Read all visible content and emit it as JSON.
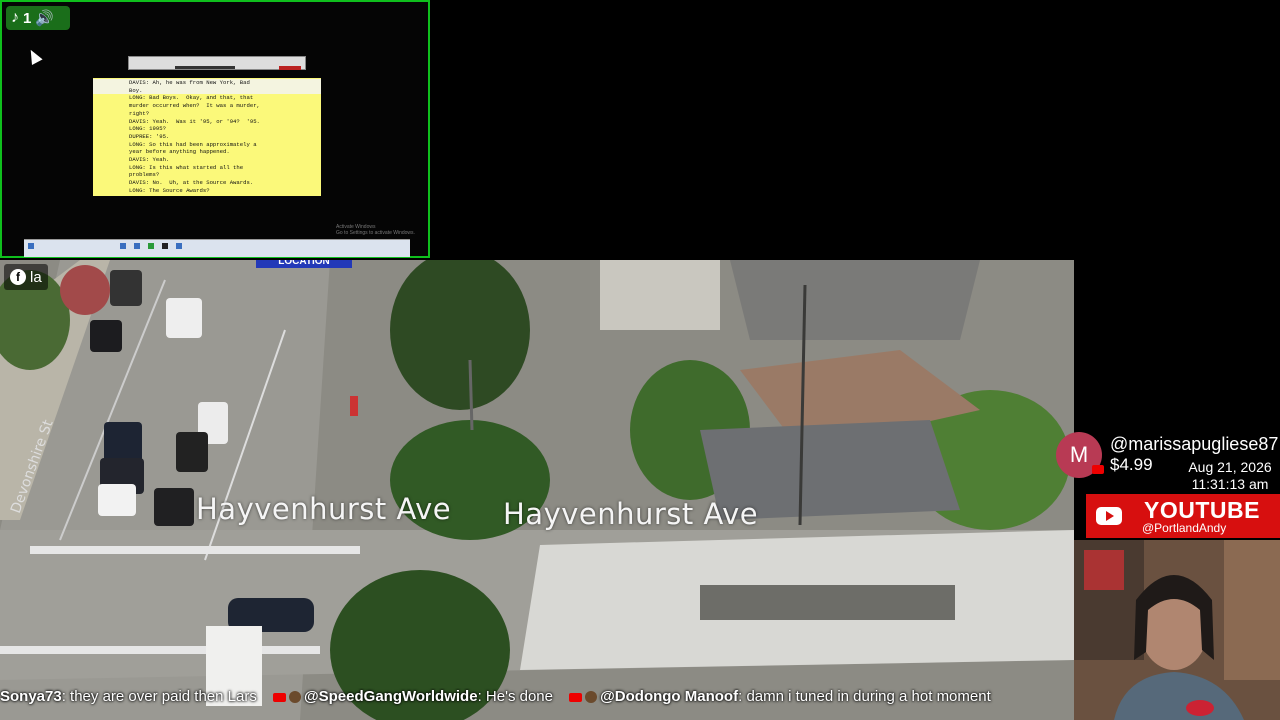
{
  "tiktok": {
    "count": "1"
  },
  "facebook": {
    "label": "la"
  },
  "document": {
    "lines": [
      "DAVIS: Ah, he was from New York, Bad",
      "Boy.",
      "LONG: Bad Boys.  Okay, and that, that",
      "murder occurred when?  It was a murder,",
      "right?",
      "DAVIS: Yeah.  Was it '95, or '94?  '95.",
      "LONG: 1995?",
      "DUPREE: '95.",
      "LONG: So this had been approximately a",
      "year before anything happened.",
      "DAVIS: Yeah.",
      "LONG: Is this what started all the",
      "problems?",
      "DAVIS: No.  Uh, at the Source Awards.",
      "LONG: The Source Awards?"
    ],
    "watermark": "Activate Windows\nGo to Settings to activate Windows."
  },
  "video": {
    "location_tag": "LOCATION",
    "street_label_1": "Hayvenhurst Ave",
    "street_label_2": "Hayvenhurst Ave",
    "cross_street": "Devonshire St"
  },
  "donation": {
    "avatar_letter": "M",
    "name": "@marissapugliese87",
    "amount": "$4.99",
    "date": "Aug 21, 2026",
    "time": "11:31:13 am"
  },
  "youtube_banner": {
    "title": "YOUTUBE",
    "handle": "@PortlandAndy"
  },
  "chat": [
    {
      "user": "Sonya73",
      "text": "they are over paid then Lars",
      "source": "youtube"
    },
    {
      "user": "@SpeedGangWorldwide",
      "text": "He's done",
      "source": "youtube"
    },
    {
      "user": "@Dodongo Manoof",
      "text": "damn i tuned in during a hot moment",
      "source": "youtube"
    }
  ],
  "colors": {
    "share_border": "#0fbf1d",
    "youtube_red": "#d70f0f",
    "transcript_bg": "#fbf97a"
  }
}
